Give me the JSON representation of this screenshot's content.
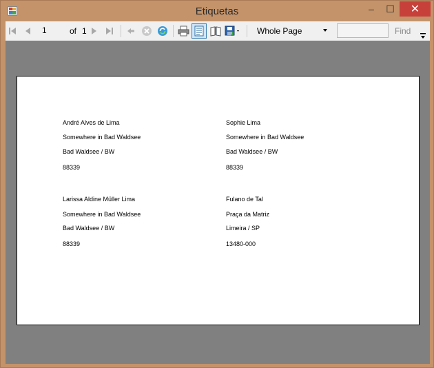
{
  "window": {
    "title": "Etiquetas",
    "controls": {
      "minimize": "–",
      "maximize": "☐",
      "close": "✕"
    }
  },
  "toolbar": {
    "current_page": "1",
    "of_label": "of",
    "total_pages": "1",
    "zoom": "Whole Page",
    "find_placeholder": "",
    "find_label": "Find",
    "icons": [
      "first-page-icon",
      "previous-page-icon",
      "next-page-icon",
      "last-page-icon",
      "back-icon",
      "stop-icon",
      "refresh-icon",
      "print-icon",
      "print-layout-icon",
      "page-setup-icon",
      "export-icon"
    ]
  },
  "labels": [
    {
      "lines": [
        "André Alves de Lima",
        "Somewhere in Bad Waldsee",
        "Bad Waldsee / BW",
        "88339"
      ]
    },
    {
      "lines": [
        "Sophie Lima",
        "Somewhere in Bad Waldsee",
        "Bad Waldsee / BW",
        "88339"
      ]
    },
    {
      "lines": [
        "Larissa Aldine Müller Lima",
        "Somewhere in Bad Waldsee",
        "Bad Waldsee / BW",
        "88339"
      ]
    },
    {
      "lines": [
        "Fulano de Tal",
        "Praça da Matriz",
        "Limeira / SP",
        "13480-000"
      ]
    }
  ],
  "colors": {
    "frame": "#c4936a",
    "viewer_bg": "#808080",
    "close_button": "#c7403a",
    "toolbar_bg": "#f0f0f0"
  }
}
